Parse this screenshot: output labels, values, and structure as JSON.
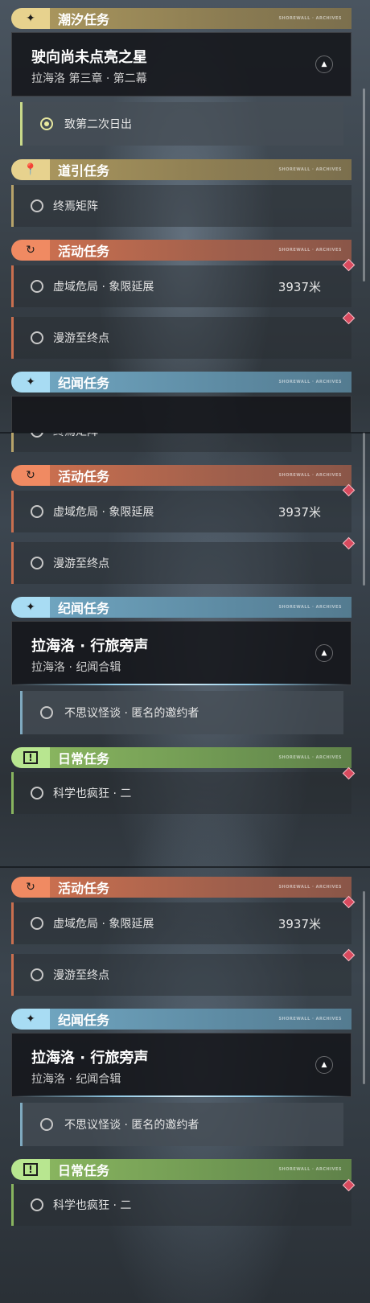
{
  "categories": {
    "tide": {
      "label": "潮汐任务",
      "icon": "sparkle-icon"
    },
    "guide": {
      "label": "道引任务",
      "icon": "map-pin-icon"
    },
    "event": {
      "label": "活动任务",
      "icon": "refresh-icon"
    },
    "chronicle": {
      "label": "纪闻任务",
      "icon": "sparkle-icon"
    },
    "daily": {
      "label": "日常任务",
      "icon": "exclamation-icon"
    }
  },
  "header_tag": "SHOREWALL · ARCHIVES",
  "tide_quest": {
    "title": "驶向尚未点亮之星",
    "subtitle": "拉海洛 第三章 · 第二幕",
    "objective": "致第二次日出"
  },
  "guide_quest": {
    "name": "终焉矩阵"
  },
  "event_quests": [
    {
      "name": "虚域危局 · 象限延展",
      "distance": "3937米"
    },
    {
      "name": "漫游至终点"
    }
  ],
  "chronicle_quest": {
    "title": "拉海洛 · 行旅旁声",
    "subtitle": "拉海洛 · 纪闻合辑",
    "objective": "不思议怪谈 · 匿名的邀约者"
  },
  "daily_quest": {
    "name": "科学也疯狂 · 二"
  },
  "colors": {
    "tide": "#e7d28e",
    "event": "#f08a62",
    "chronicle": "#a8dcf3",
    "daily": "#b8e690",
    "marker": "#d94a5e"
  }
}
